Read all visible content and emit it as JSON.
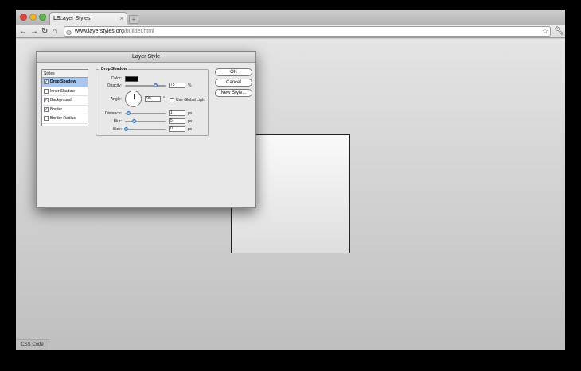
{
  "browser": {
    "tab_title": "Layer Styles",
    "tab_favicon": "LS",
    "url_domain": "www.layerstyles.org",
    "url_path": "/builder.html",
    "icons": {
      "back": "back-arrow-icon",
      "forward": "forward-arrow-icon",
      "reload": "reload-icon",
      "home": "home-icon",
      "star": "star-icon",
      "wrench": "wrench-icon"
    }
  },
  "page": {
    "css_code_label": "CSS Code"
  },
  "dialog": {
    "title": "Layer Style",
    "styles_header": "Styles",
    "style_items": [
      {
        "label": "Drop Shadow",
        "checked": true,
        "selected": true
      },
      {
        "label": "Inner Shadow",
        "checked": false,
        "selected": false
      },
      {
        "label": "Background",
        "checked": true,
        "selected": false
      },
      {
        "label": "Border",
        "checked": true,
        "selected": false
      },
      {
        "label": "Border Radius",
        "checked": false,
        "selected": false
      }
    ],
    "drop_shadow": {
      "legend": "Drop Shadow",
      "color_label": "Color:",
      "color_value": "#000000",
      "opacity_label": "Opacity:",
      "opacity_value": "75",
      "opacity_unit": "%",
      "angle_label": "Angle:",
      "angle_value": "90",
      "angle_unit": "°",
      "use_global_light_label": "Use Global Light",
      "use_global_light_checked": false,
      "distance_label": "Distance:",
      "distance_value": "1",
      "distance_unit": "px",
      "blur_label": "Blur:",
      "blur_value": "5",
      "blur_unit": "px",
      "size_label": "Size:",
      "size_value": "0",
      "size_unit": "px"
    },
    "buttons": {
      "ok": "OK",
      "cancel": "Cancel",
      "new_style": "New Style..."
    }
  }
}
